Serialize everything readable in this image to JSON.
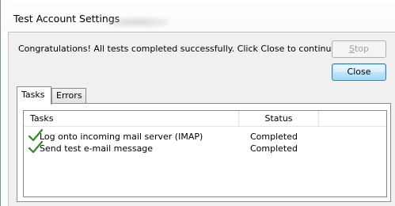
{
  "window": {
    "title": "Test Account Settings"
  },
  "message": "Congratulations! All tests completed successfully. Click Close to continue.",
  "buttons": {
    "stop_label_accel": "S",
    "stop_label_rest": "top",
    "close_label": "Close"
  },
  "tabs": [
    {
      "label": "Tasks",
      "selected": true
    },
    {
      "label": "Errors",
      "selected": false
    }
  ],
  "list": {
    "columns": [
      "Tasks",
      "Status"
    ],
    "rows": [
      {
        "icon": "checkmark-icon",
        "task": "Log onto incoming mail server (IMAP)",
        "status": "Completed"
      },
      {
        "icon": "checkmark-icon",
        "task": "Send test e-mail message",
        "status": "Completed"
      }
    ]
  },
  "colors": {
    "check_green": "#2e8b1f",
    "dialog_bg": "#f0f0f0",
    "close_accent": "#3c7fb1"
  }
}
